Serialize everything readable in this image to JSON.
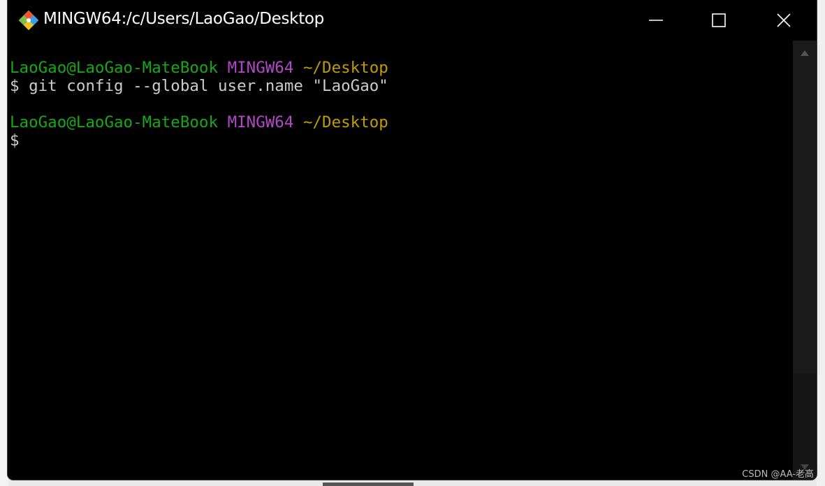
{
  "window": {
    "title": "MINGW64:/c/Users/LaoGao/Desktop",
    "app_icon": "git-bash-icon",
    "controls": {
      "minimize": "minimize-icon",
      "maximize": "maximize-icon",
      "close": "close-icon"
    }
  },
  "terminal": {
    "prompt1": {
      "user_host": "LaoGao@LaoGao-MateBook",
      "system": "MINGW64",
      "path": "~/Desktop"
    },
    "command1": "$ git config --global user.name \"LaoGao\"",
    "prompt2": {
      "user_host": "LaoGao@LaoGao-MateBook",
      "system": "MINGW64",
      "path": "~/Desktop"
    },
    "command2": "$",
    "colors": {
      "user_host": "#16a816",
      "system": "#b148c6",
      "path": "#c19c00",
      "text": "#cccccc"
    }
  },
  "watermark": "CSDN @AA-老高"
}
